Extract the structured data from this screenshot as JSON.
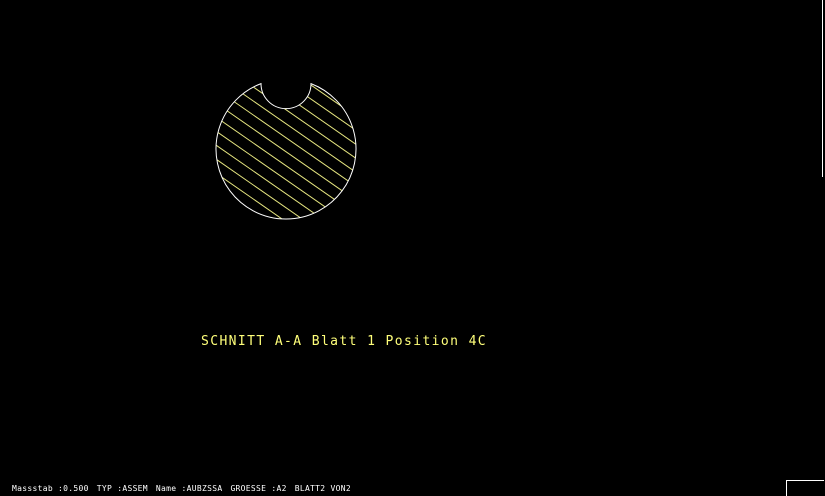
{
  "drawing": {
    "section_caption": "SCHNITT A-A Blatt 1 Position 4C",
    "outline_color": "#ffffff",
    "hatch_color": "#e6e680",
    "caption_color": "#ffff7a"
  },
  "status_bar": {
    "massstab": "Massstab :0.500",
    "typ": "TYP :ASSEM",
    "name": "Name :AUBZSSA",
    "groesse": "GROESSE :A2",
    "blatt": "BLATT2 VON2"
  }
}
